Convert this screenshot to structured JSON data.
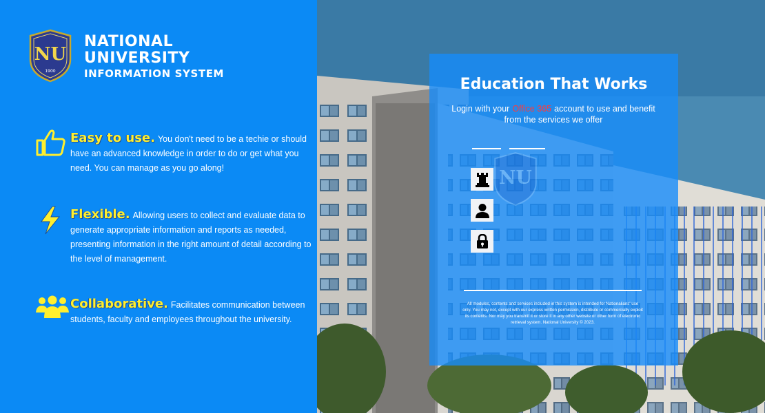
{
  "brand": {
    "line1": "NATIONAL",
    "line2": "UNIVERSITY",
    "line3": "INFORMATION SYSTEM",
    "seal_text": "NU",
    "seal_year": "1900"
  },
  "features": [
    {
      "title": "Easy to use.",
      "icon": "thumbs-up-icon",
      "text": "You don't need to be a techie or should have an advanced knowledge in order to do or get what you need. You can manage as you go along!"
    },
    {
      "title": "Flexible.",
      "icon": "lightning-bolt-icon",
      "text": "Allowing users to collect and evaluate data to generate appropriate information and reports as needed, presenting information in the right amount of detail according to the level of management."
    },
    {
      "title": "Collaborative.",
      "icon": "users-group-icon",
      "text": "Facilitates communication between students, faculty and employees throughout the university."
    }
  ],
  "login": {
    "heading": "Education That Works",
    "sub_before": "Login with your",
    "sub_highlight": "Office 365",
    "sub_after": "account to use  and benefit from the services we offer",
    "fields": [
      {
        "icon": "castle-rook-icon"
      },
      {
        "icon": "user-icon"
      },
      {
        "icon": "lock-icon"
      }
    ],
    "legal": "All modules, contents and services included in this system is intended for Nationalians' use only. You may not, except with our express written permission, distribute or commercially exploit its contents. Nor may you transmit it or store it in any other website or other form of electronic retrieval system. National University © 2023."
  },
  "colors": {
    "left_bg": "#0b8af5",
    "card_bg": "#168cfa",
    "feature_title": "#ffef2e",
    "highlight": "#ff3a3a"
  }
}
